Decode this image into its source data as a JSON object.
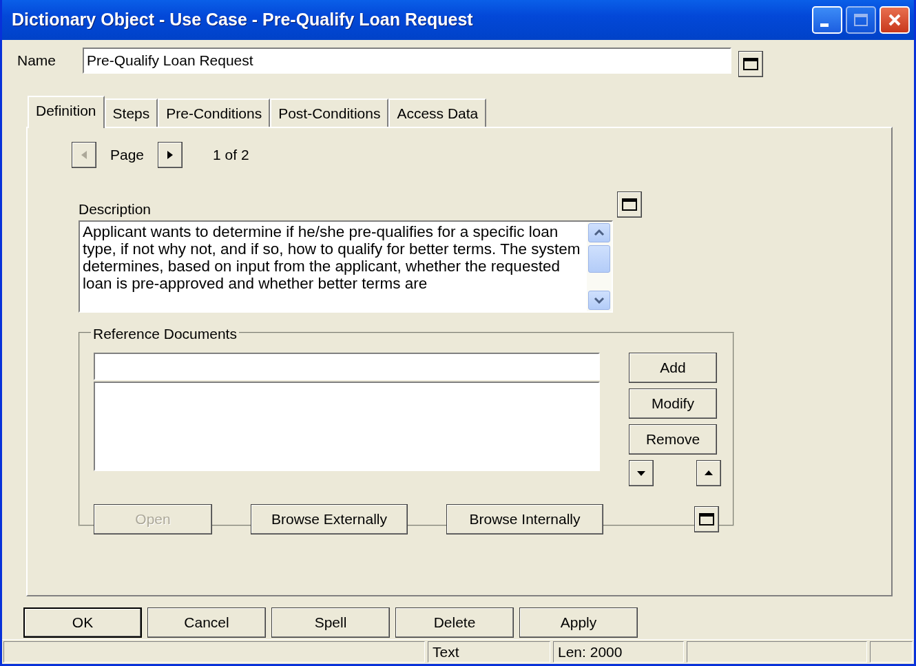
{
  "window": {
    "title": "Dictionary Object - Use Case - Pre-Qualify Loan Request"
  },
  "name_field": {
    "label": "Name",
    "value": "Pre-Qualify Loan Request"
  },
  "tabs": [
    {
      "label": "Definition",
      "selected": true
    },
    {
      "label": "Steps",
      "selected": false
    },
    {
      "label": "Pre-Conditions",
      "selected": false
    },
    {
      "label": "Post-Conditions",
      "selected": false
    },
    {
      "label": "Access Data",
      "selected": false
    }
  ],
  "pager": {
    "label": "Page",
    "reading": "1 of 2",
    "prev_disabled": true,
    "next_disabled": false
  },
  "description": {
    "label": "Description",
    "value": "Applicant wants to determine if he/she pre-qualifies for a specific loan type, if not why not, and if so, how to qualify for better terms. The system determines, based on input from the applicant, whether the requested loan is pre-approved and whether better terms are"
  },
  "reference_documents": {
    "title": "Reference Documents",
    "side_buttons": [
      {
        "label": "Add",
        "disabled": false
      },
      {
        "label": "Modify",
        "disabled": false
      },
      {
        "label": "Remove",
        "disabled": false
      }
    ],
    "actions": [
      {
        "label": "Open",
        "disabled": true
      },
      {
        "label": "Browse Externally",
        "disabled": false
      },
      {
        "label": "Browse Internally",
        "disabled": false
      }
    ]
  },
  "dialog_buttons": [
    {
      "label": "OK",
      "default": true
    },
    {
      "label": "Cancel",
      "default": false
    },
    {
      "label": "Spell",
      "default": false
    },
    {
      "label": "Delete",
      "default": false
    },
    {
      "label": "Apply",
      "default": false
    }
  ],
  "status_bar": {
    "panes": [
      {
        "text": "Text"
      },
      {
        "text": "Len: 2000"
      }
    ]
  }
}
